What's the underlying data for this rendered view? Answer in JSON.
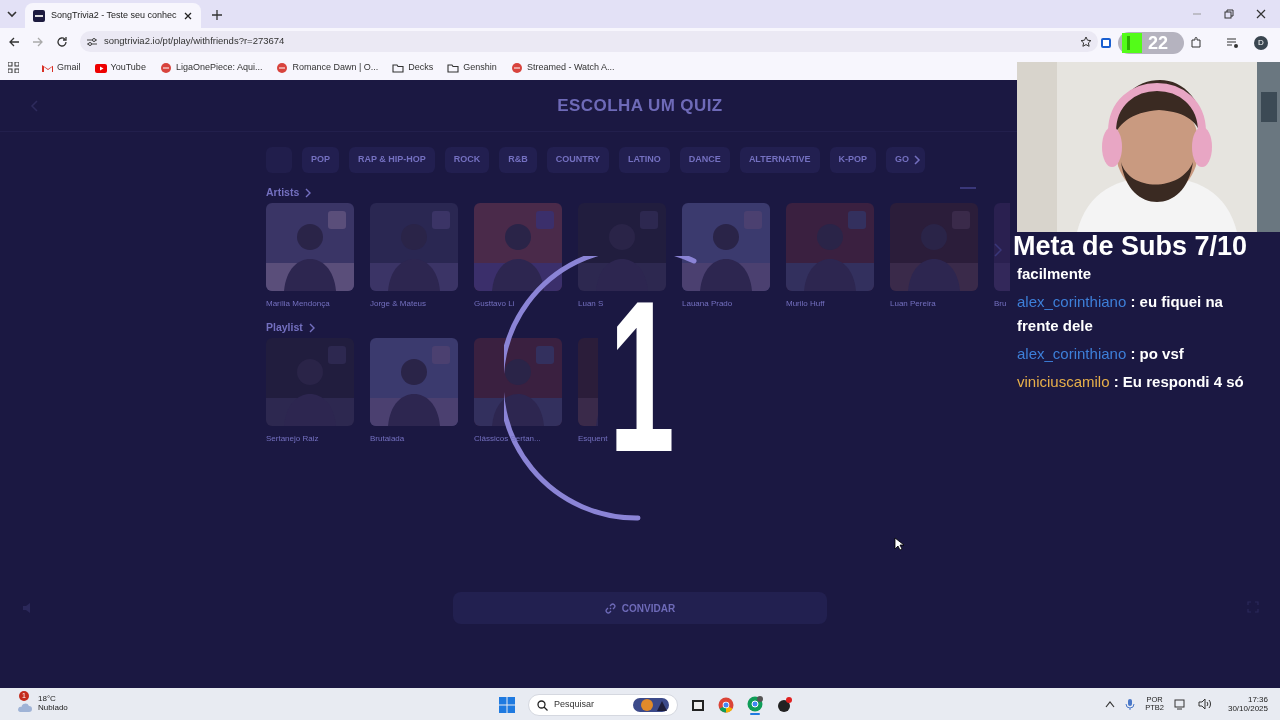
{
  "browser": {
    "tab": {
      "title": "SongTrivia2 - Teste seu conhec"
    },
    "url": "songtrivia2.io/pt/play/withfriends?r=273674",
    "extension_badge": "22",
    "profile_initial": "D",
    "bookmarks": [
      {
        "kind": "gmail",
        "label": "Gmail"
      },
      {
        "kind": "youtube",
        "label": "YouTube"
      },
      {
        "kind": "site",
        "label": "LigaOnePiece: Aqui..."
      },
      {
        "kind": "site",
        "label": "Romance Dawn | O..."
      },
      {
        "kind": "folder",
        "label": "Decks"
      },
      {
        "kind": "folder",
        "label": "Genshin"
      },
      {
        "kind": "site",
        "label": "Streamed - Watch A..."
      }
    ]
  },
  "page": {
    "title": "ESCOLHA UM QUIZ",
    "genres": [
      {
        "label": "POP"
      },
      {
        "label": "RAP & HIP-HOP"
      },
      {
        "label": "ROCK"
      },
      {
        "label": "R&B"
      },
      {
        "label": "COUNTRY"
      },
      {
        "label": "LATINO"
      },
      {
        "label": "DANCE"
      },
      {
        "label": "ALTERNATIVE"
      },
      {
        "label": "K-POP"
      },
      {
        "label": "GO"
      }
    ],
    "sections": [
      {
        "title": "Artists",
        "items": [
          {
            "label": "Marília Mendonça"
          },
          {
            "label": "Jorge & Mateus"
          },
          {
            "label": "Gusttavo Li"
          },
          {
            "label": "Luan S"
          },
          {
            "label": "Lauana Prado"
          },
          {
            "label": "Murilo Huff"
          },
          {
            "label": "Luan Pereira"
          },
          {
            "label": "Bru"
          }
        ]
      },
      {
        "title": "Playlist",
        "items": [
          {
            "label": "Sertanejo Raiz"
          },
          {
            "label": "Brutaiada"
          },
          {
            "label": "Clássicos Sertan..."
          },
          {
            "label": "Esquent"
          }
        ]
      }
    ],
    "countdown": "1",
    "invite_button": "CONVIDAR"
  },
  "stream_overlay": {
    "goal": "Meta de Subs 7/10",
    "chat": [
      {
        "text": "facilmente"
      },
      {
        "user": "alex_corinthiano",
        "color": "#3d7fd9",
        "text": ": eu fiquei na frente dele"
      },
      {
        "user": "alex_corinthiano",
        "color": "#3d7fd9",
        "text": ": po vsf"
      },
      {
        "user": "viniciuscamilo",
        "color": "#e8b04a",
        "text": ": Eu respondi 4 só"
      }
    ]
  },
  "taskbar": {
    "weather_badge": "1",
    "temperature": "18°C",
    "condition": "Nublado",
    "search_label": "Pesquisar",
    "language": "POR",
    "layout": "PTB2",
    "time": "17:36",
    "date": "30/10/2025"
  }
}
